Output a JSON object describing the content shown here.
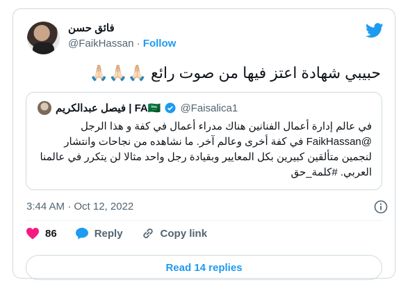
{
  "tweet": {
    "author_name": "فائق حسن",
    "author_handle": "@FaikHassan",
    "separator": "·",
    "follow_label": "Follow",
    "text": "حبيبي شهادة اعتز فيها من صوت رائع 🙏🏻🙏🏻🙏🏻",
    "timestamp": "3:44 AM · Oct 12, 2022"
  },
  "quote": {
    "author_name": "FA🇸🇦 | فيصل عبدالكريم",
    "author_handle": "@Faisalica1",
    "text": "في عالم إدارة أعمال الفنانين هناك مدراء أعمال في كفة و هذا الرجل @FaikHassan في كفة أخرى وعالم آخر. ما نشاهده من نجاحات وانتشار لنجمين متألقين كبيرين بكل المعايير وبقيادة رجل واحد مثالا لن يتكرر في عالمنا العربي. #كلمة_حق"
  },
  "actions": {
    "like_count": "86",
    "reply_label": "Reply",
    "copy_link_label": "Copy link"
  },
  "read_replies_label": "Read 14 replies",
  "colors": {
    "accent": "#1d9bf0",
    "like": "#f91880",
    "text": "#0f1419",
    "muted": "#536471",
    "border": "#cfd9de"
  },
  "icons": {
    "brand": "twitter-bird-icon",
    "verified": "verified-badge-icon",
    "info": "info-icon",
    "like": "heart-icon",
    "reply": "speech-bubble-icon",
    "copy_link": "link-icon"
  }
}
